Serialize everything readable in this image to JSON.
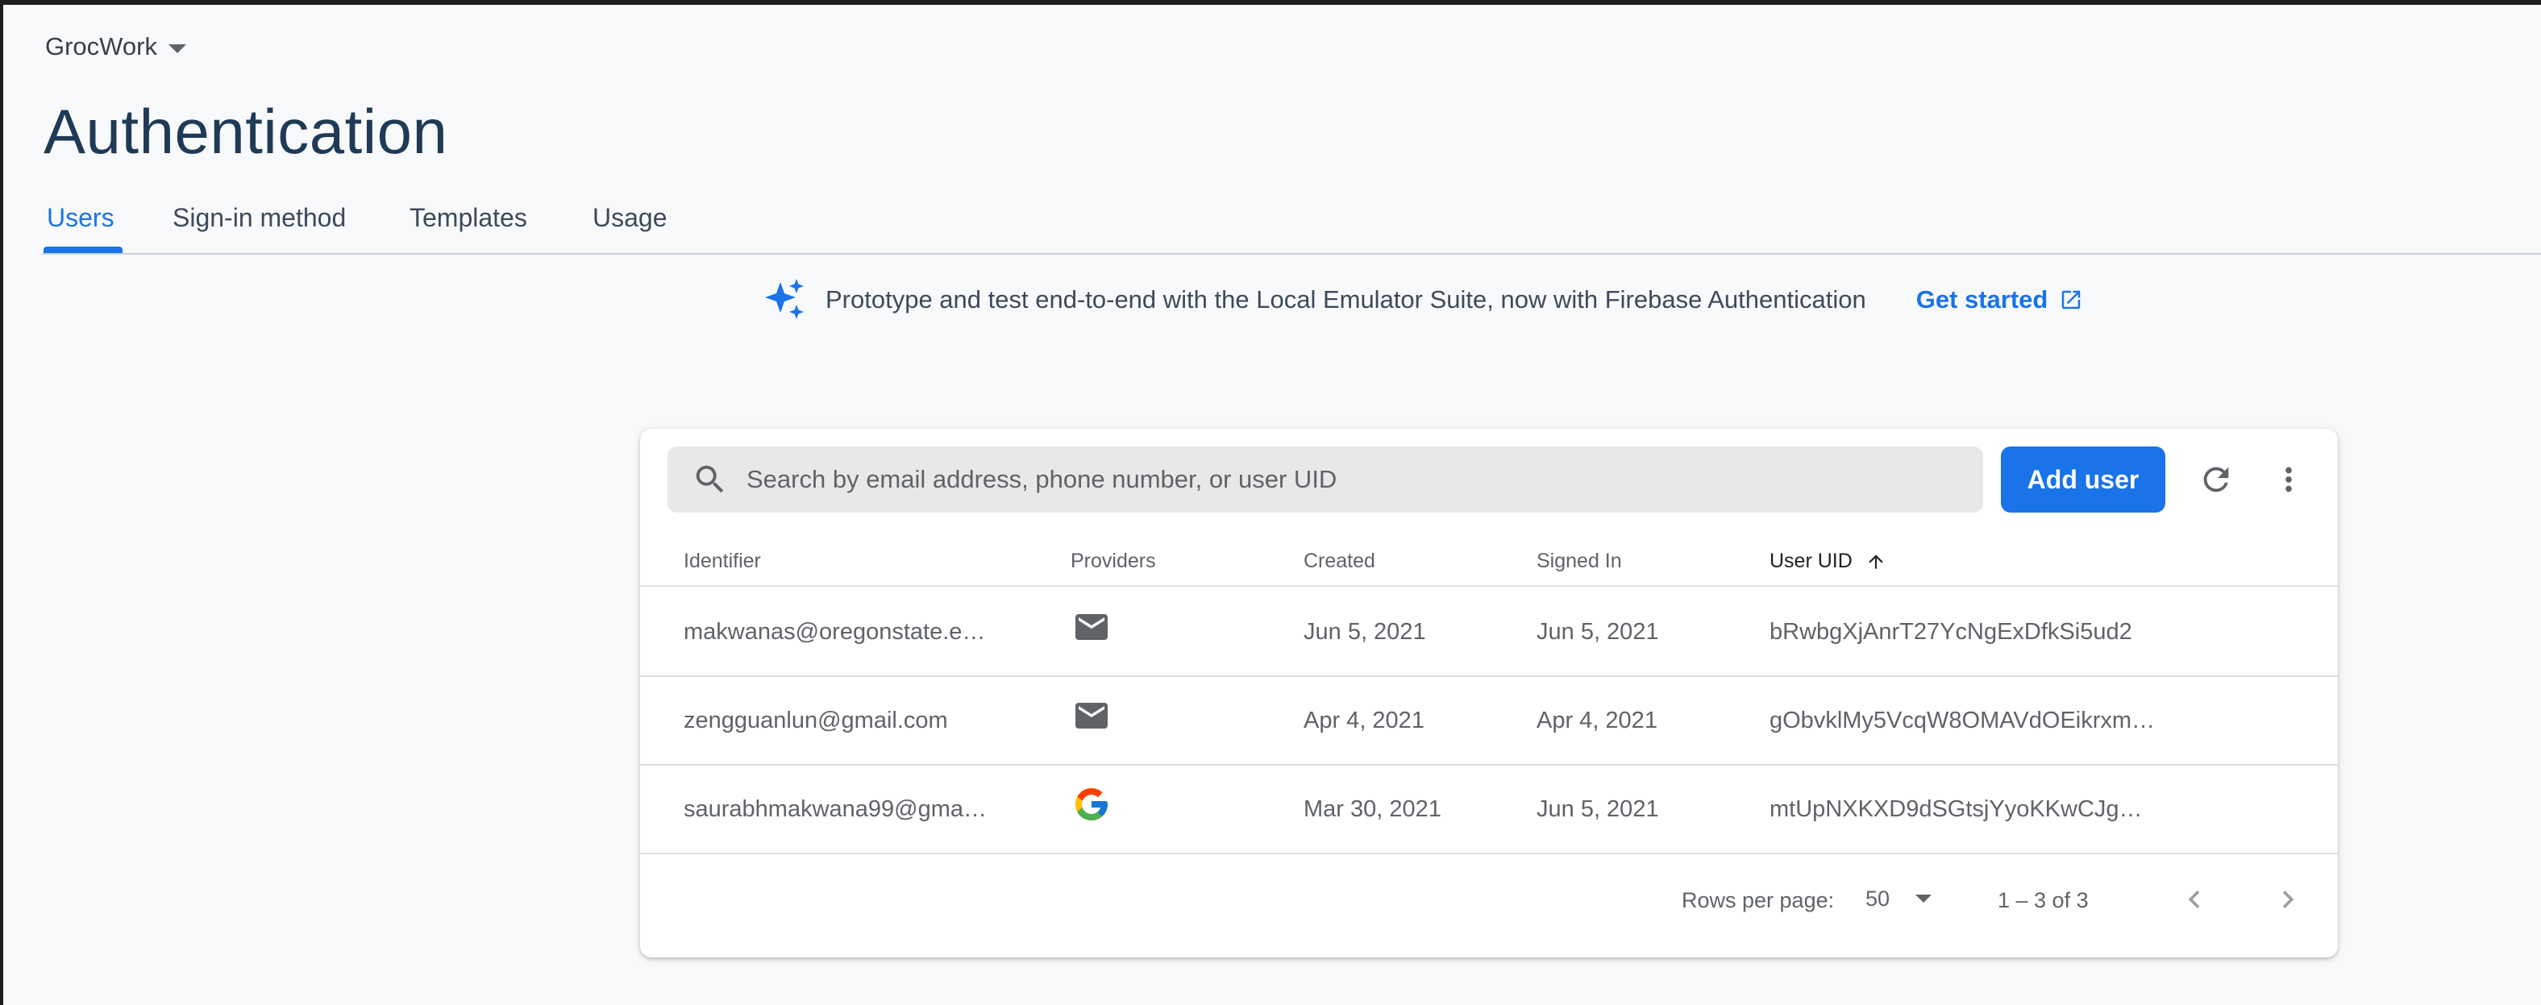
{
  "project": {
    "name": "GrocWork"
  },
  "page": {
    "title": "Authentication"
  },
  "tabs": [
    {
      "label": "Users",
      "active": true
    },
    {
      "label": "Sign-in method",
      "active": false
    },
    {
      "label": "Templates",
      "active": false
    },
    {
      "label": "Usage",
      "active": false
    }
  ],
  "banner": {
    "icon": "sparkle-icon",
    "text": "Prototype and test end-to-end with the Local Emulator Suite, now with Firebase Authentication",
    "link_label": "Get started",
    "link_icon": "open-in-new-icon"
  },
  "toolbar": {
    "search_placeholder": "Search by email address, phone number, or user UID",
    "search_value": "",
    "add_user_label": "Add user",
    "refresh_icon": "refresh-icon",
    "more_icon": "more-vert-icon"
  },
  "table": {
    "columns": [
      "Identifier",
      "Providers",
      "Created",
      "Signed In",
      "User UID"
    ],
    "sorted_column": "User UID",
    "sort_direction": "ascending",
    "rows": [
      {
        "identifier": "makwanas@oregonstate.e…",
        "provider": "email-icon",
        "created": "Jun 5, 2021",
        "signed_in": "Jun 5, 2021",
        "uid": "bRwbgXjAnrT27YcNgExDfkSi5ud2"
      },
      {
        "identifier": "zengguanlun@gmail.com",
        "provider": "email-icon",
        "created": "Apr 4, 2021",
        "signed_in": "Apr 4, 2021",
        "uid": "gObvklMy5VcqW8OMAVdOEikrxm…"
      },
      {
        "identifier": "saurabhmakwana99@gma…",
        "provider": "google-icon",
        "created": "Mar 30, 2021",
        "signed_in": "Jun 5, 2021",
        "uid": "mtUpNXKXD9dSGtsjYyoKKwCJgP…"
      }
    ]
  },
  "pagination": {
    "rows_per_page_label": "Rows per page:",
    "rows_per_page_value": "50",
    "range_label": "1 – 3 of 3"
  },
  "colors": {
    "accent": "#1a73e8",
    "title": "#1f3a56",
    "background": "#f8f9fa"
  }
}
